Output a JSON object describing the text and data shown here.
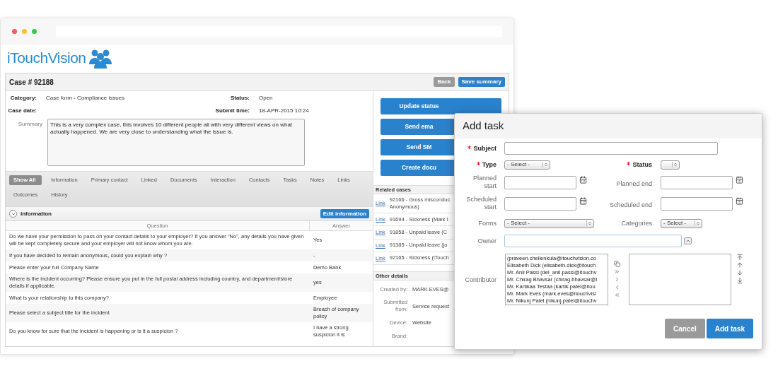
{
  "logo_text": "iTouchVision",
  "case": {
    "title": "Case # 92188",
    "actions": [
      {
        "label": "Back",
        "kind": "secondary"
      },
      {
        "label": "Save summary",
        "kind": "primary"
      }
    ],
    "details": [
      {
        "label": "Category:",
        "value": "Case form - Compliance issues"
      },
      {
        "label": "Status:",
        "value": "Open"
      },
      {
        "label": "Case date:"
      },
      {
        "label": "Submit time:",
        "value": "18-APR-2015 10:24"
      }
    ],
    "summary": {
      "label": "Summary",
      "value": "This is a very complex case, this involves 10 different people all with very different views on what actually happened. We are very close to understanding what the issue is."
    },
    "tabs": [
      {
        "label": "Show All",
        "selected": true
      },
      {
        "label": "Information",
        "selected": false
      },
      {
        "label": "Primary contact",
        "selected": false
      },
      {
        "label": "Linked",
        "selected": false
      },
      {
        "label": "Documents",
        "selected": false
      },
      {
        "label": "Interaction",
        "selected": false
      },
      {
        "label": "Contacts",
        "selected": false
      },
      {
        "label": "Tasks",
        "selected": false
      },
      {
        "label": "Notes",
        "selected": false
      },
      {
        "label": "Links",
        "selected": false
      },
      {
        "label": "Outcomes",
        "selected": false
      },
      {
        "label": "History",
        "selected": false
      }
    ],
    "information": {
      "title": "Information",
      "expanded": true,
      "edit_button": "Edit information",
      "columns": [
        "Question",
        "Answer"
      ],
      "rows": [
        {
          "question": "Do we have your permission to pass on your contact details to your employer? If you answer \"No\", any details you have given will be kept completely secure and your employer will not know whom you are.",
          "answer": "Yes"
        },
        {
          "question": "If you have decided to remain anonymous, could you explain why ?",
          "answer": "-"
        },
        {
          "question": "Please enter your full Company Name",
          "answer": "Demo Bank"
        },
        {
          "question": "Where is the incident occurring? Please ensure you put in the full postal address including country, and department/store details if applicable.",
          "answer": "yes"
        },
        {
          "question": "What is your relationship to this company?",
          "answer": "Employee"
        },
        {
          "question": "Please select a subject title for the incident",
          "answer": "Breach of company policy"
        },
        {
          "question": "Do you know for sure that the incident is happening or is it a suspicion ?",
          "answer": "I have a strong suspicion it is"
        }
      ]
    },
    "side_actions": [
      "Update status",
      "Send ema",
      "Send SM",
      "Create docu"
    ],
    "related_cases": {
      "title": "Related cases",
      "rows": [
        {
          "link": "Link",
          "lines": [
            "92166 - Gross misconduc",
            "Anonymous)"
          ]
        },
        {
          "link": "Link",
          "lines": [
            "91694 - Sickness (Mark I"
          ]
        },
        {
          "link": "Link",
          "lines": [
            "91858 - Unpaid leave (C"
          ]
        },
        {
          "link": "Link",
          "lines": [
            "91385 - Unpaid leave (jo"
          ]
        },
        {
          "link": "Link",
          "lines": [
            "92165 - Sickness (iTouch"
          ]
        }
      ]
    },
    "other_details": {
      "title": "Other details",
      "rows": [
        {
          "label": "Created by:",
          "value": "MARK.EVES@"
        },
        {
          "label": "Submitted from:",
          "value": "Service request"
        },
        {
          "label": "Device:",
          "value": "Website"
        },
        {
          "label": "Brand:"
        }
      ]
    }
  },
  "add_task": {
    "title": "Add task",
    "subject": {
      "label": "Subject",
      "required": true
    },
    "type": {
      "label": "Type",
      "required": true,
      "value": "- Select -"
    },
    "status": {
      "label": "Status",
      "required": true
    },
    "planned_start": {
      "label": "Planned start"
    },
    "planned_end": {
      "label": "Planned end"
    },
    "scheduled_start": {
      "label": "Scheduled start"
    },
    "scheduled_end": {
      "label": "Scheduled end"
    },
    "forms": {
      "label": "Forms",
      "value": "- Select -"
    },
    "categories": {
      "label": "Categories",
      "value": "- Select -"
    },
    "owner": {
      "label": "Owner"
    },
    "contributor": {
      "label": "Contributor",
      "options": [
        "(praveen.chellenkula@itouchvision.co",
        "Elisabeth Dick (elisabeth.dick@itouch",
        "Mr. Anil Passi (del_anil.passi@itouchv",
        "Mr. Chirag Bhavsar (chirag.bhavsar@i",
        "Mr. Kartikaa Testaa (kartik.patel@itou",
        "Mr. Mark Eves (mark.eves@itouchvisi",
        "Mr. Nikunj Patel (nikunj.patel@itouchv"
      ]
    },
    "buttons": [
      {
        "label": "Cancel",
        "kind": "secondary"
      },
      {
        "label": "Add task",
        "kind": "primary"
      }
    ]
  }
}
